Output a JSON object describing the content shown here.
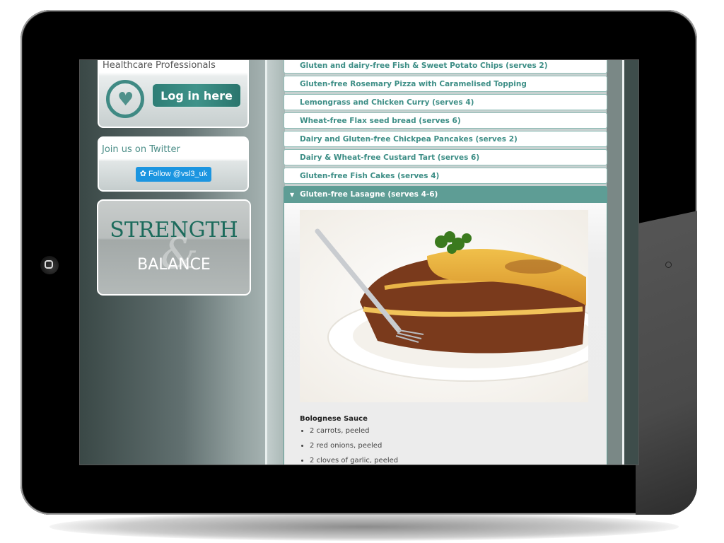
{
  "device": {
    "type": "tablet",
    "orientation": "landscape"
  },
  "sidebar": {
    "healthcare": {
      "title": "Healthcare Professionals",
      "login_label": "Log in here",
      "icon": "heart-ring-icon"
    },
    "twitter": {
      "title": "Join us on Twitter",
      "follow_label": "Follow @vsl3_uk",
      "icon": "twitter-bird-icon"
    },
    "banner": {
      "line1": "STRENGTH",
      "ampersand": "&",
      "line2": "BALANCE"
    }
  },
  "recipes": {
    "items": [
      {
        "label": "Gluten and dairy-free Fish & Sweet Potato Chips (serves 2)"
      },
      {
        "label": "Gluten-free Rosemary Pizza with Caramelised Topping"
      },
      {
        "label": "Lemongrass and Chicken Curry (serves 4)"
      },
      {
        "label": "Wheat-free Flax seed bread (serves 6)"
      },
      {
        "label": "Dairy and Gluten-free Chickpea Pancakes (serves 2)"
      },
      {
        "label": "Dairy & Wheat-free Custard Tart (serves 6)"
      },
      {
        "label": "Gluten-free Fish Cakes (serves 4)"
      }
    ],
    "active": {
      "label": "Gluten-free Lasagne (serves 4-6)",
      "image_alt": "Plate of lasagne with fork and parsley garnish",
      "section_title": "Bolognese Sauce",
      "ingredients": [
        "2 carrots, peeled",
        "2 red onions, peeled",
        "2 cloves of garlic, peeled"
      ]
    }
  },
  "colors": {
    "accent": "#5e9d95",
    "link": "#3d8e86",
    "login_button": "#2e7e76",
    "twitter_blue": "#1b95e0",
    "banner_green": "#1c6b5c"
  }
}
